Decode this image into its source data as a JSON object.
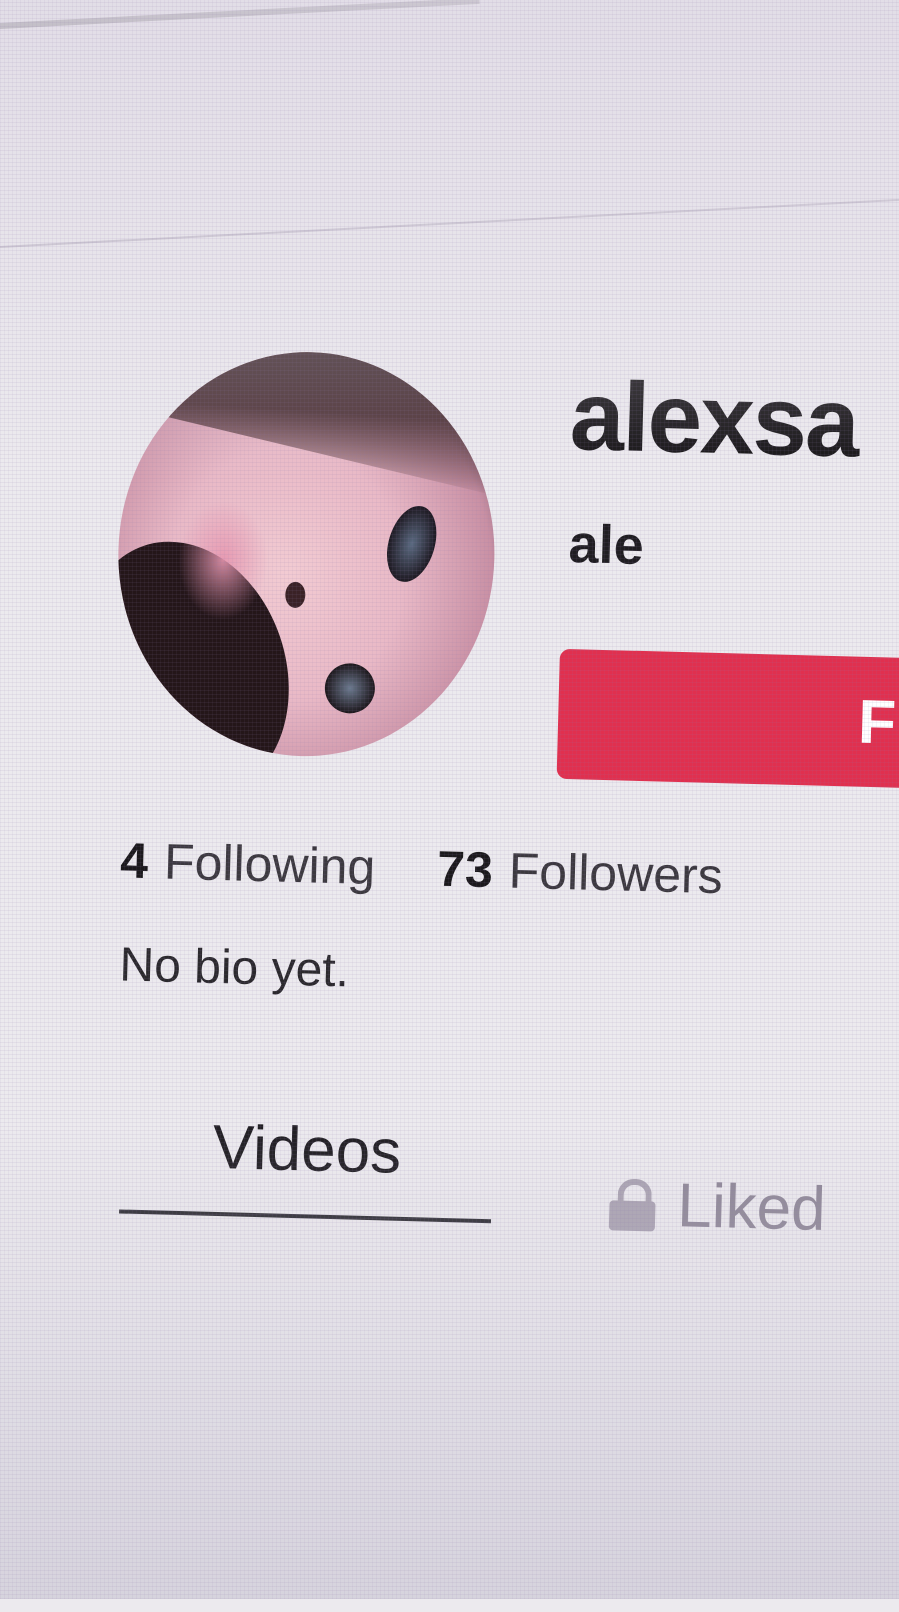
{
  "profile": {
    "username": "alexsa",
    "display_name": "ale",
    "follow_button_label": "F"
  },
  "stats": {
    "following_count": "4",
    "following_label": "Following",
    "followers_count": "73",
    "followers_label": "Followers"
  },
  "bio": "No bio yet.",
  "tabs": [
    {
      "label": "Videos",
      "active": true
    },
    {
      "label": "Liked",
      "locked": true
    }
  ],
  "colors": {
    "follow_button": "#e0304f",
    "text_primary": "#141214",
    "tab_inactive": "#8e8796"
  },
  "icons": {
    "liked_tab_icon": "lock-icon"
  }
}
